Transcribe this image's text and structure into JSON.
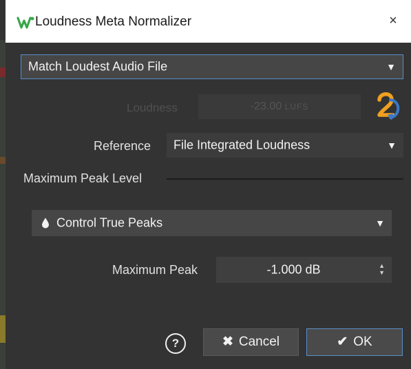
{
  "window": {
    "title": "Loudness Meta Normalizer",
    "logo_icon": "wavelab-logo-icon",
    "close_glyph": "×"
  },
  "mode": {
    "selected": "Match Loudest Audio File",
    "arrow": "▼"
  },
  "loudness": {
    "label": "Loudness",
    "value": "-23.00",
    "unit": "LUFS",
    "enabled": false
  },
  "pass_icon": "two-pass-icon",
  "reference": {
    "label": "Reference",
    "selected": "File Integrated Loudness",
    "arrow": "▼"
  },
  "section": {
    "title": "Maximum Peak Level"
  },
  "peak_mode": {
    "icon": "drop-icon",
    "selected": "Control True Peaks",
    "arrow": "▼"
  },
  "max_peak": {
    "label": "Maximum Peak",
    "value": "-1.000 dB",
    "stepper_up": "▲",
    "stepper_down": "▼"
  },
  "buttons": {
    "help": "?",
    "cancel_label": "Cancel",
    "cancel_icon": "✖",
    "ok_label": "OK",
    "ok_icon": "✔"
  },
  "colors": {
    "accent": "#5a8fc8",
    "background": "#333333",
    "pass_icon_orange": "#f0a020",
    "pass_icon_blue": "#3a78c8"
  }
}
